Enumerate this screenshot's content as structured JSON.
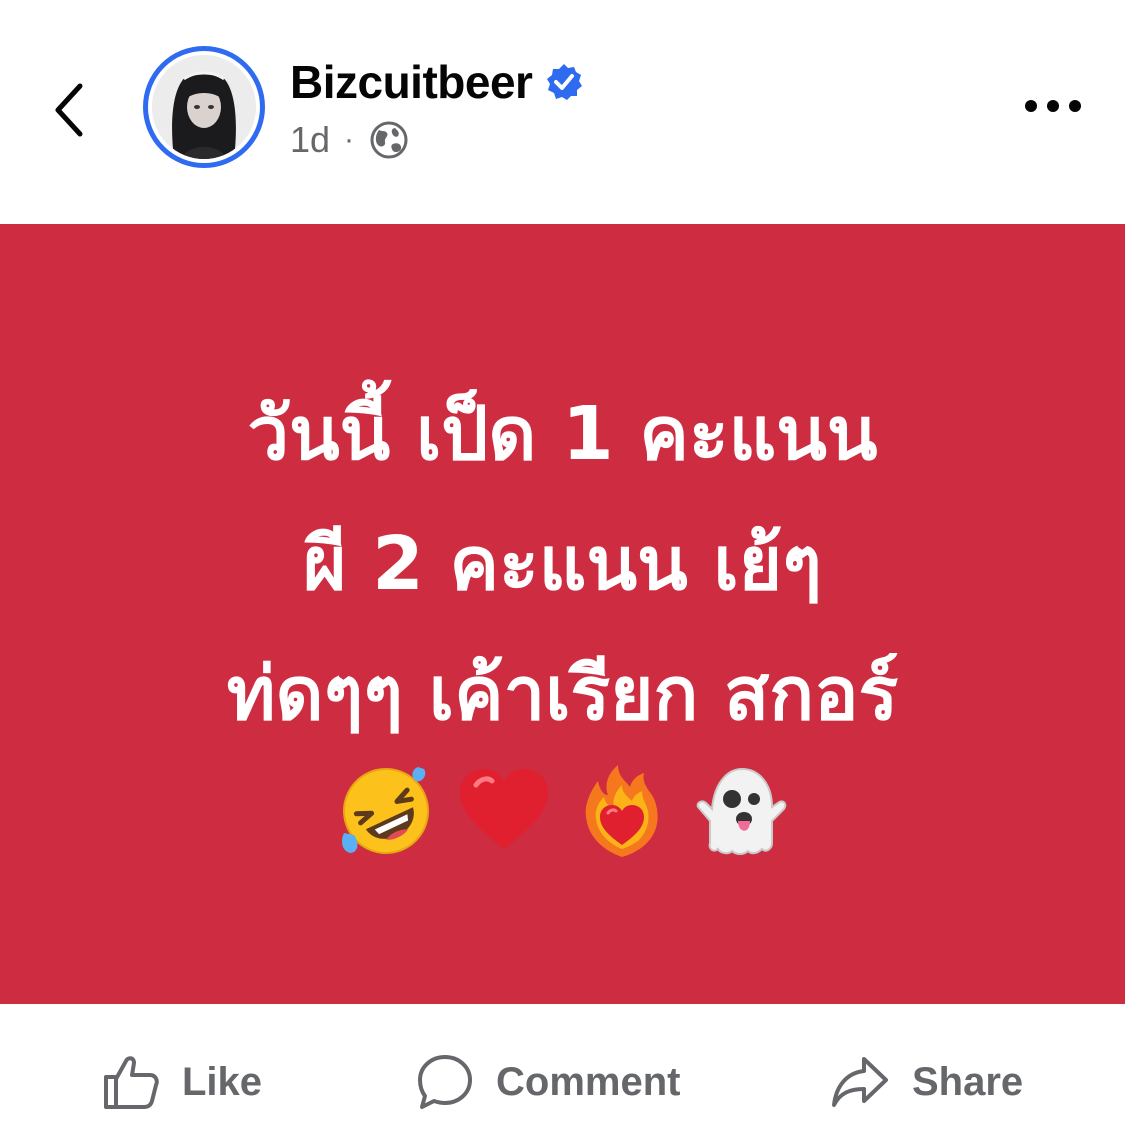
{
  "header": {
    "back_icon": "chevron-left-icon",
    "author_name": "Bizcuitbeer",
    "verified_icon": "verified-badge-icon",
    "timestamp": "1d",
    "separator": "·",
    "privacy_icon": "globe-icon",
    "more_icon": "more-horizontal-icon",
    "ring_color": "#2f6bf0"
  },
  "post": {
    "background_color": "#cd2c41",
    "lines": [
      "วันนี้ เป็ด 1 คะแนน",
      "ผี 2 คะแนน เย้ๆ",
      "ท่ดๆๆ เค้าเรียก สกอร์"
    ],
    "emojis": [
      "rolling-laughing-icon",
      "red-heart-icon",
      "heart-on-fire-icon",
      "ghost-icon"
    ]
  },
  "actions": {
    "like_label": "Like",
    "comment_label": "Comment",
    "share_label": "Share"
  }
}
